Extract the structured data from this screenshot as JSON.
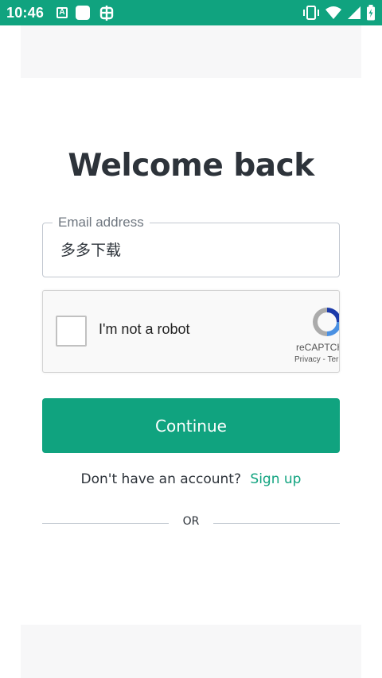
{
  "status_bar": {
    "time": "10:46",
    "app_icon_letter": "A",
    "left_icons": [
      "a-box-icon",
      "white-square-icon",
      "bug-icon"
    ],
    "right_icons": [
      "vibrate-icon",
      "wifi-icon",
      "signal-icon",
      "battery-icon"
    ]
  },
  "login": {
    "title": "Welcome back",
    "email": {
      "label": "Email address",
      "value": "多多下载"
    },
    "captcha": {
      "label": "I'm not a robot",
      "brand": "reCAPTCHA",
      "links": "Privacy - Terms"
    },
    "continue_label": "Continue",
    "signup_prompt": "Don't have an account?",
    "signup_link": "Sign up",
    "divider_text": "OR"
  },
  "colors": {
    "accent": "#10a37f",
    "text": "#2d333a",
    "border": "#c2c8d0",
    "panel": "#f7f7f8"
  }
}
